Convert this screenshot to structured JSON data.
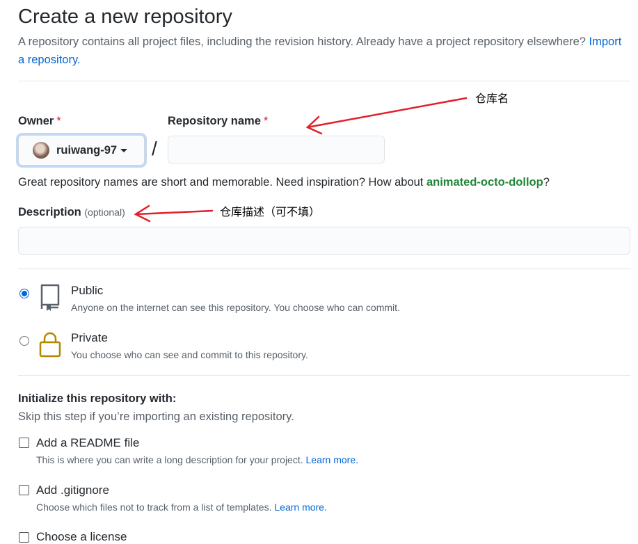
{
  "page": {
    "title": "Create a new repository",
    "intro": "A repository contains all project files, including the revision history. Already have a project repository elsewhere?",
    "import_link": "Import a repository."
  },
  "owner": {
    "label": "Owner",
    "required_mark": "*",
    "name": "ruiwang-97"
  },
  "repo_name": {
    "label": "Repository name",
    "required_mark": "*",
    "separator": "/",
    "value": "",
    "hint_prefix": "Great repository names are short and memorable. Need inspiration? How about ",
    "suggestion": "animated-octo-dollop",
    "hint_suffix": "?"
  },
  "description": {
    "label": "Description",
    "optional": "(optional)",
    "value": ""
  },
  "annotations": {
    "repo_name": "仓库名",
    "description": "仓库描述（可不填）"
  },
  "visibility": {
    "public": {
      "title": "Public",
      "desc": "Anyone on the internet can see this repository. You choose who can commit.",
      "checked": true
    },
    "private": {
      "title": "Private",
      "desc": "You choose who can see and commit to this repository.",
      "checked": false
    }
  },
  "initialize": {
    "heading": "Initialize this repository with:",
    "subheading": "Skip this step if you’re importing an existing repository.",
    "readme": {
      "title": "Add a README file",
      "desc": "This is where you can write a long description for your project.",
      "link": "Learn more."
    },
    "gitignore": {
      "title": "Add .gitignore",
      "desc": "Choose which files not to track from a list of templates.",
      "link": "Learn more."
    },
    "license": {
      "title": "Choose a license"
    }
  },
  "colors": {
    "link": "#0366d6",
    "suggestion": "#22863a",
    "required": "#cb2431",
    "annotation_arrow": "#e0202a",
    "lock_icon": "#b08800"
  }
}
